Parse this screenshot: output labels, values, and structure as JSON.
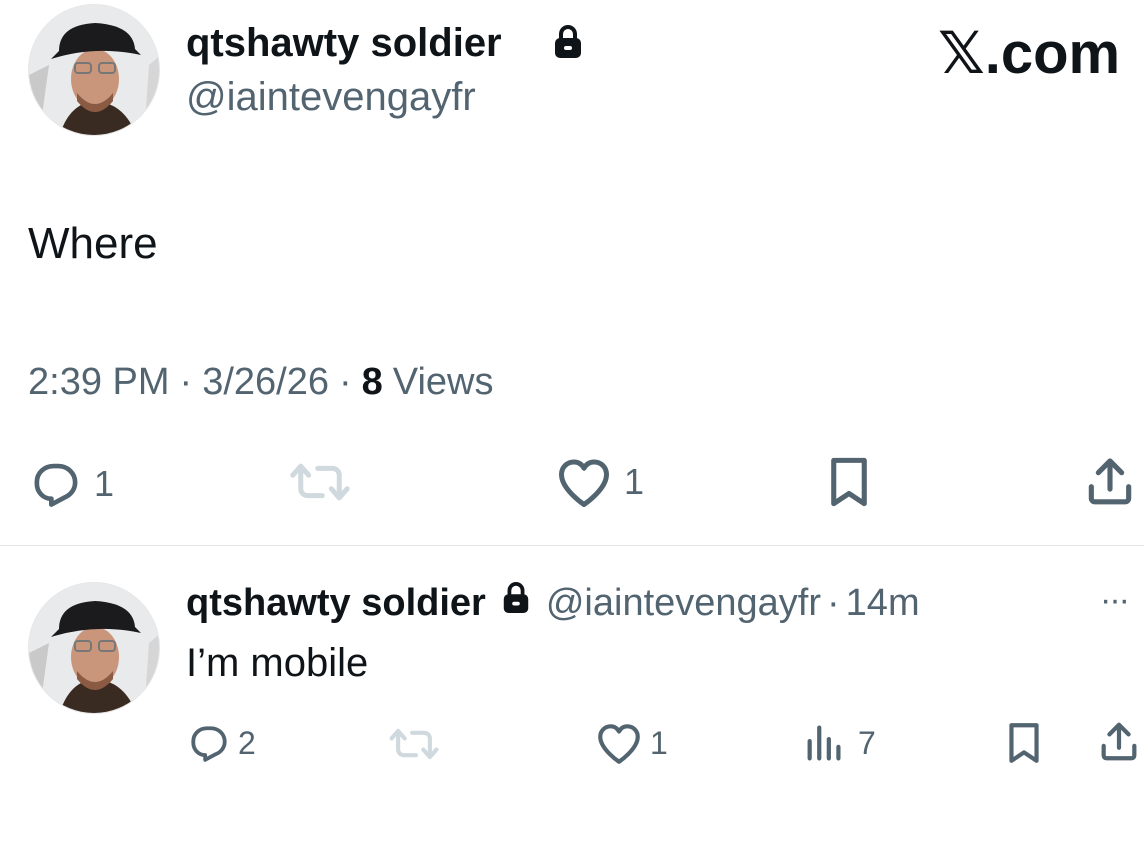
{
  "watermark": "𝕏.com",
  "main_tweet": {
    "display_name": "qtshawty soldier",
    "handle": "@iaintevengayfr",
    "text": "Where",
    "time": "2:39 PM",
    "date": "3/26/26",
    "separator": "·",
    "views_count": "8",
    "views_label": "Views",
    "actions": {
      "reply_count": "1",
      "like_count": "1"
    }
  },
  "reply_tweet": {
    "display_name": "qtshawty soldier",
    "handle": "@iaintevengayfr",
    "separator": "·",
    "age": "14m",
    "more_label": "···",
    "text": "I’m mobile",
    "actions": {
      "reply_count": "2",
      "like_count": "1",
      "views_count": "7"
    }
  },
  "colors": {
    "text": "#0f1419",
    "muted": "#536471",
    "retweet_disabled": "#cfd9de",
    "divider": "#e3e7ea"
  },
  "icons": [
    "lock-icon",
    "reply-icon",
    "retweet-icon",
    "like-icon",
    "bookmark-icon",
    "share-icon",
    "views-icon",
    "more-icon"
  ]
}
